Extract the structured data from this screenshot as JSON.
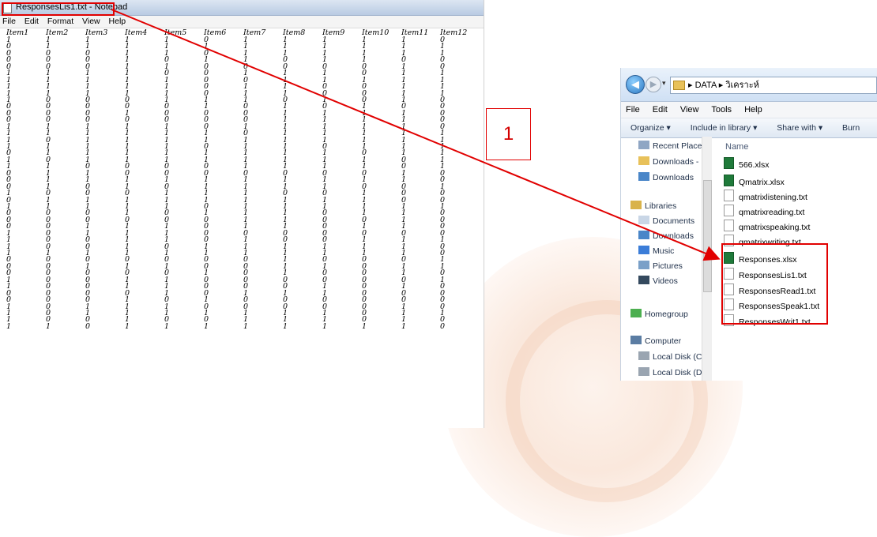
{
  "notepad": {
    "title": "ResponsesLis1.txt - Notepad",
    "menu": [
      "File",
      "Edit",
      "Format",
      "View",
      "Help"
    ],
    "headers": [
      "Item1",
      "Item2",
      "Item3",
      "Item4",
      "Item5",
      "Item6",
      "Item7",
      "Item8",
      "Item9",
      "Item10",
      "Item11",
      "Item12"
    ],
    "rows": [
      "1 1 1 1 1 0 1 1 1 1 1 0",
      "0 1 1 1 1 1 1 1 1 1 1 1",
      "0 0 0 1 1 0 1 1 1 1 1 1",
      "0 0 0 1 0 1 1 0 1 1 0 0",
      "0 0 0 1 1 0 0 0 0 0 1 0",
      "1 1 1 1 0 0 1 1 1 0 1 1",
      "1 1 1 1 1 0 0 1 1 1 1 1",
      "1 1 1 1 1 0 1 1 0 0 1 1",
      "1 1 1 1 1 0 1 1 0 0 1 1",
      "1 0 0 0 1 1 1 0 1 0 1 0",
      "0 0 0 0 0 1 0 1 0 1 0 0",
      "0 0 0 1 0 0 0 1 1 1 1 0",
      "0 0 0 0 0 0 0 1 1 1 1 0",
      "1 1 1 1 1 0 1 1 1 1 1 0",
      "1 1 1 1 1 1 0 1 1 1 1 1",
      "1 0 1 1 1 1 1 1 1 1 1 1",
      "1 1 1 1 1 0 1 1 0 1 1 1",
      "0 1 1 1 1 1 1 1 1 0 1 1",
      "1 0 1 1 1 1 1 1 1 1 0 1",
      "1 1 0 0 0 0 1 1 1 1 0 1",
      "0 1 1 0 0 0 0 0 0 0 1 0",
      "0 1 1 1 1 1 1 1 1 1 1 0",
      "0 1 0 1 0 1 1 1 1 0 0 1",
      "1 0 0 0 1 1 1 0 0 1 0 0",
      "0 1 1 1 1 1 1 1 1 1 0 0",
      "1 1 1 1 1 0 1 1 1 1 1 1",
      "0 0 0 1 0 1 1 1 0 1 1 0",
      "0 0 0 0 0 0 1 1 0 0 1 0",
      "0 0 1 1 1 0 1 1 0 1 1 0",
      "1 0 1 1 1 0 0 0 0 0 0 0",
      "1 0 0 1 1 0 1 0 0 1 1 1",
      "1 0 0 1 0 1 1 1 1 1 1 0",
      "1 1 1 1 1 1 1 1 1 1 1 0",
      "0 0 0 0 0 0 0 1 0 0 0 1",
      "0 0 1 1 1 0 0 1 1 0 1 1",
      "0 0 0 0 0 1 0 1 0 0 1 0",
      "1 0 0 1 1 0 0 0 0 0 0 1",
      "1 0 0 1 1 0 0 0 1 0 1 0",
      "0 0 0 0 1 0 1 1 1 0 0 0",
      "0 0 0 1 0 1 0 0 0 0 0 0",
      "1 0 1 1 1 0 0 0 0 0 1 0",
      "1 0 1 1 1 1 1 1 1 0 1 1",
      "1 0 0 1 0 0 1 1 1 0 1 0",
      "1 1 0 1 1 1 1 1 1 1 1 0"
    ]
  },
  "callout": {
    "number": "1"
  },
  "explorer": {
    "breadcrumb": [
      "DATA",
      "วิเคราะห์"
    ],
    "menu": [
      "File",
      "Edit",
      "View",
      "Tools",
      "Help"
    ],
    "toolbar": [
      "Organize ▾",
      "Include in library ▾",
      "Share with ▾",
      "Burn"
    ],
    "column_header": "Name",
    "nav": [
      {
        "label": "Recent Place",
        "icon": "recent-places-icon"
      },
      {
        "label": "Downloads -",
        "icon": "folder-icon"
      },
      {
        "label": "Downloads",
        "icon": "downloads-folder-icon"
      },
      {
        "label": "Libraries",
        "icon": "libraries-icon"
      },
      {
        "label": "Documents",
        "icon": "documents-icon"
      },
      {
        "label": "Downloads",
        "icon": "downloads-folder-icon"
      },
      {
        "label": "Music",
        "icon": "music-icon"
      },
      {
        "label": "Pictures",
        "icon": "pictures-icon"
      },
      {
        "label": "Videos",
        "icon": "videos-icon"
      },
      {
        "label": "Homegroup",
        "icon": "homegroup-icon"
      },
      {
        "label": "Computer",
        "icon": "computer-icon"
      },
      {
        "label": "Local Disk (C",
        "icon": "local-disk-icon"
      },
      {
        "label": "Local Disk (D",
        "icon": "local-disk-icon"
      }
    ],
    "files": [
      {
        "name": "566.xlsx",
        "type": "xlsx"
      },
      {
        "name": "Qmatrix.xlsx",
        "type": "xlsx"
      },
      {
        "name": "qmatrixlistening.txt",
        "type": "txt"
      },
      {
        "name": "qmatrixreading.txt",
        "type": "txt"
      },
      {
        "name": "qmatrixspeaking.txt",
        "type": "txt"
      },
      {
        "name": "qmatrixwriting.txt",
        "type": "txt"
      },
      {
        "name": "Responses.xlsx",
        "type": "xlsx"
      },
      {
        "name": "ResponsesLis1.txt",
        "type": "txt"
      },
      {
        "name": "ResponsesRead1.txt",
        "type": "txt"
      },
      {
        "name": "ResponsesSpeak1.txt",
        "type": "txt"
      },
      {
        "name": "ResponsesWrit1.txt",
        "type": "txt"
      }
    ]
  },
  "colors": {
    "annotation_red": "#e10000",
    "excel_green": "#1f7a3a"
  }
}
